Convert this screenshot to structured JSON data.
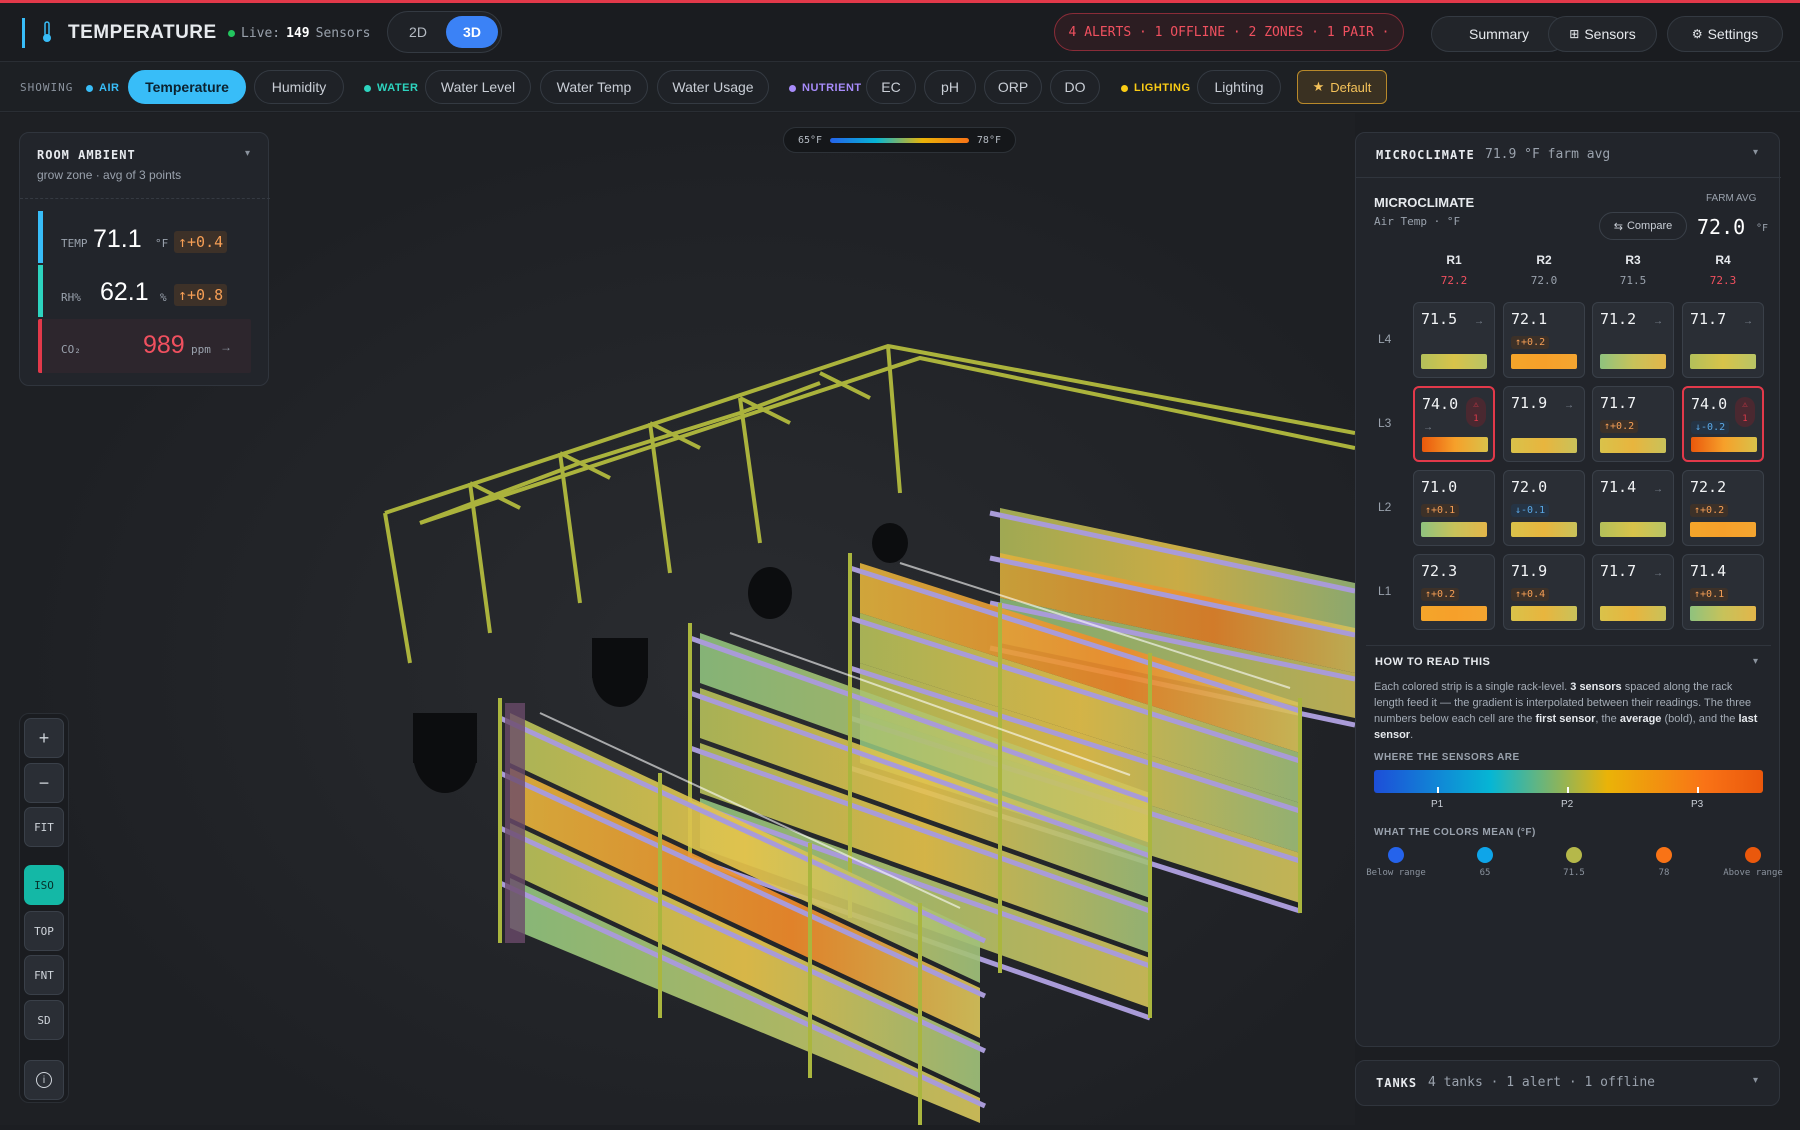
{
  "header": {
    "title": "TEMPERATURE",
    "live_label": "Live:",
    "live_count": "149",
    "live_suffix": "Sensors",
    "view_2d": "2D",
    "view_3d": "3D",
    "alerts_banner": "4 ALERTS · 1 OFFLINE · 2 ZONES · 1 PAIR ·",
    "summary_btn": "Summary",
    "sensors_btn": "Sensors",
    "settings_btn": "Settings"
  },
  "filters": {
    "showing_label": "SHOWING",
    "air_label": "AIR",
    "water_label": "WATER",
    "nutrient_label": "NUTRIENT",
    "lighting_label": "LIGHTING",
    "temperature": "Temperature",
    "humidity": "Humidity",
    "water_level": "Water Level",
    "water_temp": "Water Temp",
    "water_usage": "Water Usage",
    "ec": "EC",
    "ph": "pH",
    "orp": "ORP",
    "do": "DO",
    "lighting": "Lighting",
    "default": "Default"
  },
  "scale": {
    "min": "65°F",
    "max": "78°F"
  },
  "room": {
    "title": "ROOM AMBIENT",
    "subtitle": "grow zone · avg of 3 points",
    "temp_label": "TEMP",
    "temp_value": "71.1",
    "temp_unit": "°F",
    "temp_delta": "+0.4",
    "rh_label": "RH%",
    "rh_value": "62.1",
    "rh_unit": "%",
    "rh_delta": "+0.8",
    "co2_label": "CO₂",
    "co2_value": "989",
    "co2_unit": "ppm"
  },
  "micro": {
    "header_label": "MICROCLIMATE",
    "header_value": "71.9 °F farm avg",
    "title": "MICROCLIMATE",
    "subtitle": "Air Temp · °F",
    "farm_avg_label": "FARM AVG",
    "farm_avg_value": "72.0",
    "farm_avg_unit": "°F",
    "compare_btn": "Compare",
    "columns": [
      {
        "name": "R1",
        "avg": "72.2",
        "hot": true
      },
      {
        "name": "R2",
        "avg": "72.0",
        "hot": false
      },
      {
        "name": "R3",
        "avg": "71.5",
        "hot": false
      },
      {
        "name": "R4",
        "avg": "72.3",
        "hot": true
      }
    ],
    "rows": [
      "L4",
      "L3",
      "L2",
      "L1"
    ],
    "cells": [
      [
        {
          "v": "71.5",
          "d": "→",
          "b": "g"
        },
        {
          "v": "72.1",
          "d": "+0.2",
          "b": "o"
        },
        {
          "v": "71.2",
          "d": "→",
          "b": "g2"
        },
        {
          "v": "71.7",
          "d": "→",
          "b": "g"
        }
      ],
      [
        {
          "v": "74.0",
          "d": "→",
          "b": "r",
          "alert": "1"
        },
        {
          "v": "71.9",
          "d": "→",
          "b": "y"
        },
        {
          "v": "71.7",
          "d": "+0.2",
          "b": "y"
        },
        {
          "v": "74.0",
          "d": "-0.2",
          "b": "r",
          "alert": "1"
        }
      ],
      [
        {
          "v": "71.0",
          "d": "+0.1",
          "b": "g2"
        },
        {
          "v": "72.0",
          "d": "-0.1",
          "b": "y"
        },
        {
          "v": "71.4",
          "d": "→",
          "b": "g"
        },
        {
          "v": "72.2",
          "d": "+0.2",
          "b": "o"
        }
      ],
      [
        {
          "v": "72.3",
          "d": "+0.2",
          "b": "o"
        },
        {
          "v": "71.9",
          "d": "+0.4",
          "b": "y"
        },
        {
          "v": "71.7",
          "d": "→",
          "b": "y"
        },
        {
          "v": "71.4",
          "d": "+0.1",
          "b": "g2"
        }
      ]
    ],
    "howto_title": "HOW TO READ THIS",
    "howto_text_1": "Each colored strip is a single rack-level.",
    "howto_bold_1": "3 sensors",
    "howto_text_2": "spaced along the rack length feed it — the gradient is interpolated between their readings. The three numbers below each cell are the",
    "howto_bold_2": "first sensor",
    "howto_text_3": ", the",
    "howto_bold_3": "average",
    "howto_text_4": "(bold), and the",
    "howto_bold_4": "last sensor",
    "howto_text_5": ".",
    "where_title": "WHERE THE SENSORS ARE",
    "p1": "P1",
    "p2": "P2",
    "p3": "P3",
    "colors_title": "WHAT THE COLORS MEAN (°F)",
    "legend": [
      {
        "label": "Below range",
        "color": "#2563eb"
      },
      {
        "label": "65",
        "color": "#0ea5e9"
      },
      {
        "label": "71.5",
        "color": "#b5b84a"
      },
      {
        "label": "78",
        "color": "#f97316"
      },
      {
        "label": "Above range",
        "color": "#ea580c"
      }
    ]
  },
  "tanks": {
    "label": "TANKS",
    "value": "4 tanks · 1 alert · 1 offline"
  },
  "viewctl": {
    "zoom_in": "+",
    "zoom_out": "−",
    "fit": "FIT",
    "iso": "ISO",
    "top": "TOP",
    "fnt": "FNT",
    "sd": "SD"
  }
}
